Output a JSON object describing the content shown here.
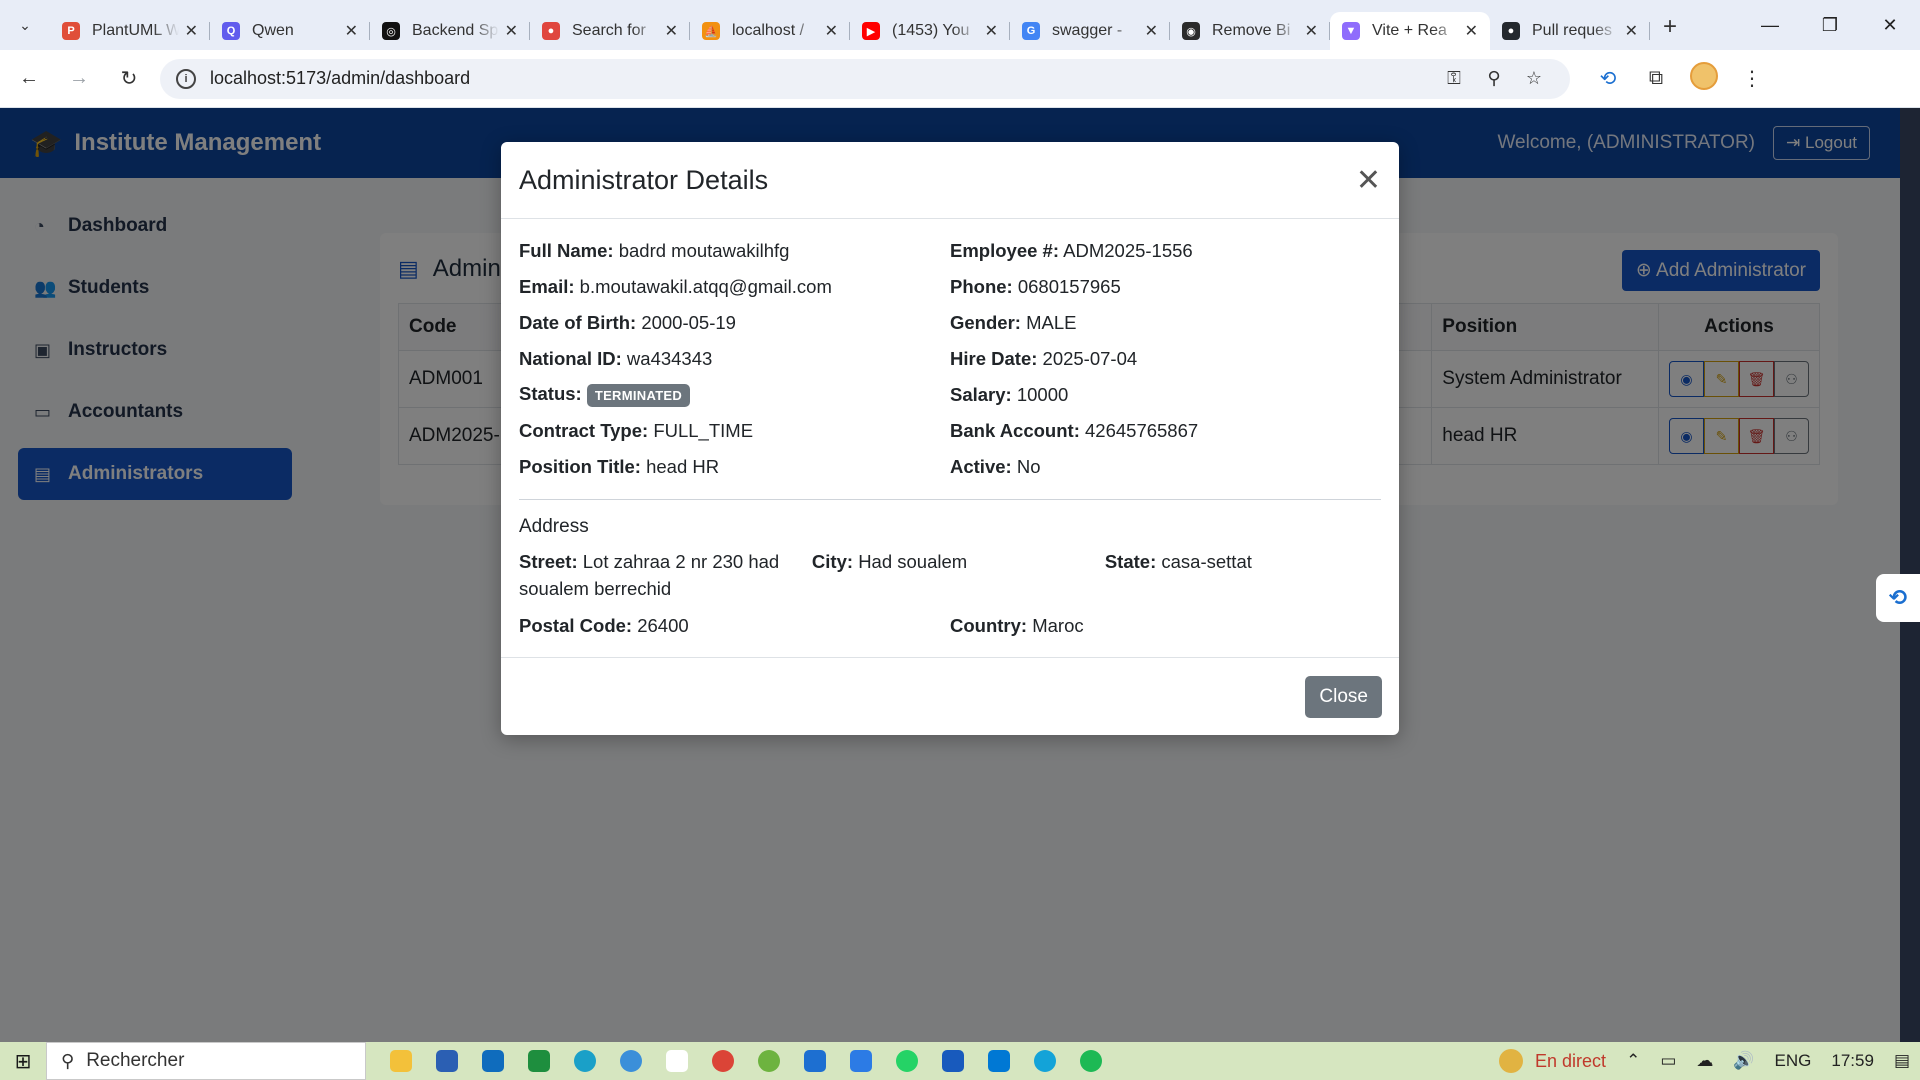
{
  "browser": {
    "tabs": [
      {
        "title": "PlantUML W",
        "fav_color": "#e04e39",
        "fav_glyph": "P"
      },
      {
        "title": "Qwen",
        "fav_color": "#615ced",
        "fav_glyph": "Q"
      },
      {
        "title": "Backend Sp",
        "fav_color": "#111111",
        "fav_glyph": "◎"
      },
      {
        "title": "Search for",
        "fav_color": "#e0463e",
        "fav_glyph": "●"
      },
      {
        "title": "localhost /",
        "fav_color": "#f29111",
        "fav_glyph": "⛵"
      },
      {
        "title": "(1453) You",
        "fav_color": "#ff0000",
        "fav_glyph": "▶"
      },
      {
        "title": "swagger -",
        "fav_color": "#4285f4",
        "fav_glyph": "G"
      },
      {
        "title": "Remove Bi",
        "fav_color": "#2b2b2b",
        "fav_glyph": "◉"
      },
      {
        "title": "Vite + Rea",
        "fav_color": "#8f6dfc",
        "fav_glyph": "▼"
      },
      {
        "title": "Pull reques",
        "fav_color": "#24292e",
        "fav_glyph": "●"
      }
    ],
    "url": "localhost:5173/admin/dashboard"
  },
  "app": {
    "brand": "Institute Management",
    "welcome": "Welcome, (ADMINISTRATOR)",
    "logout": "Logout",
    "nav": [
      {
        "label": "Dashboard",
        "icon": "gauge-icon",
        "glyph": "◔"
      },
      {
        "label": "Students",
        "icon": "people-icon",
        "glyph": "👥"
      },
      {
        "label": "Instructors",
        "icon": "badge-icon",
        "glyph": "▣"
      },
      {
        "label": "Accountants",
        "icon": "cash-icon",
        "glyph": "▭"
      },
      {
        "label": "Administrators",
        "icon": "id-card-icon",
        "glyph": "▤"
      }
    ],
    "page_title": "Admin",
    "add_button": "Add Administrator",
    "table": {
      "headers": {
        "code": "Code",
        "position": "Position",
        "actions": "Actions"
      },
      "rows": [
        {
          "code": "ADM001",
          "position": "System Administrator"
        },
        {
          "code": "ADM2025-",
          "position": "head HR"
        }
      ]
    }
  },
  "modal": {
    "title": "Administrator Details",
    "labels": {
      "full_name": "Full Name:",
      "employee_no": "Employee #:",
      "email": "Email:",
      "phone": "Phone:",
      "dob": "Date of Birth:",
      "gender": "Gender:",
      "national_id": "National ID:",
      "hire_date": "Hire Date:",
      "status": "Status:",
      "salary": "Salary:",
      "contract": "Contract Type:",
      "bank": "Bank Account:",
      "position": "Position Title:",
      "active": "Active:",
      "street": "Street:",
      "city": "City:",
      "state": "State:",
      "postal": "Postal Code:",
      "country": "Country:"
    },
    "values": {
      "full_name": "badrd moutawakilhfg",
      "employee_no": "ADM2025-1556",
      "email": "b.moutawakil.atqq@gmail.com",
      "phone": "0680157965",
      "dob": "2000-05-19",
      "gender": "MALE",
      "national_id": "wa434343",
      "hire_date": "2025-07-04",
      "status": "TERMINATED",
      "salary": "10000",
      "contract": "FULL_TIME",
      "bank": "42645765867",
      "position": "head HR",
      "active": "No",
      "street": "Lot zahraa 2 nr 230 had soualem berrechid",
      "city": "Had soualem",
      "state": "casa-settat",
      "postal": "26400",
      "country": "Maroc"
    },
    "address_heading": "Address",
    "close_button": "Close"
  },
  "taskbar": {
    "search_placeholder": "Rechercher",
    "weather_text": "En direct",
    "lang": "ENG",
    "time": "17:59"
  }
}
